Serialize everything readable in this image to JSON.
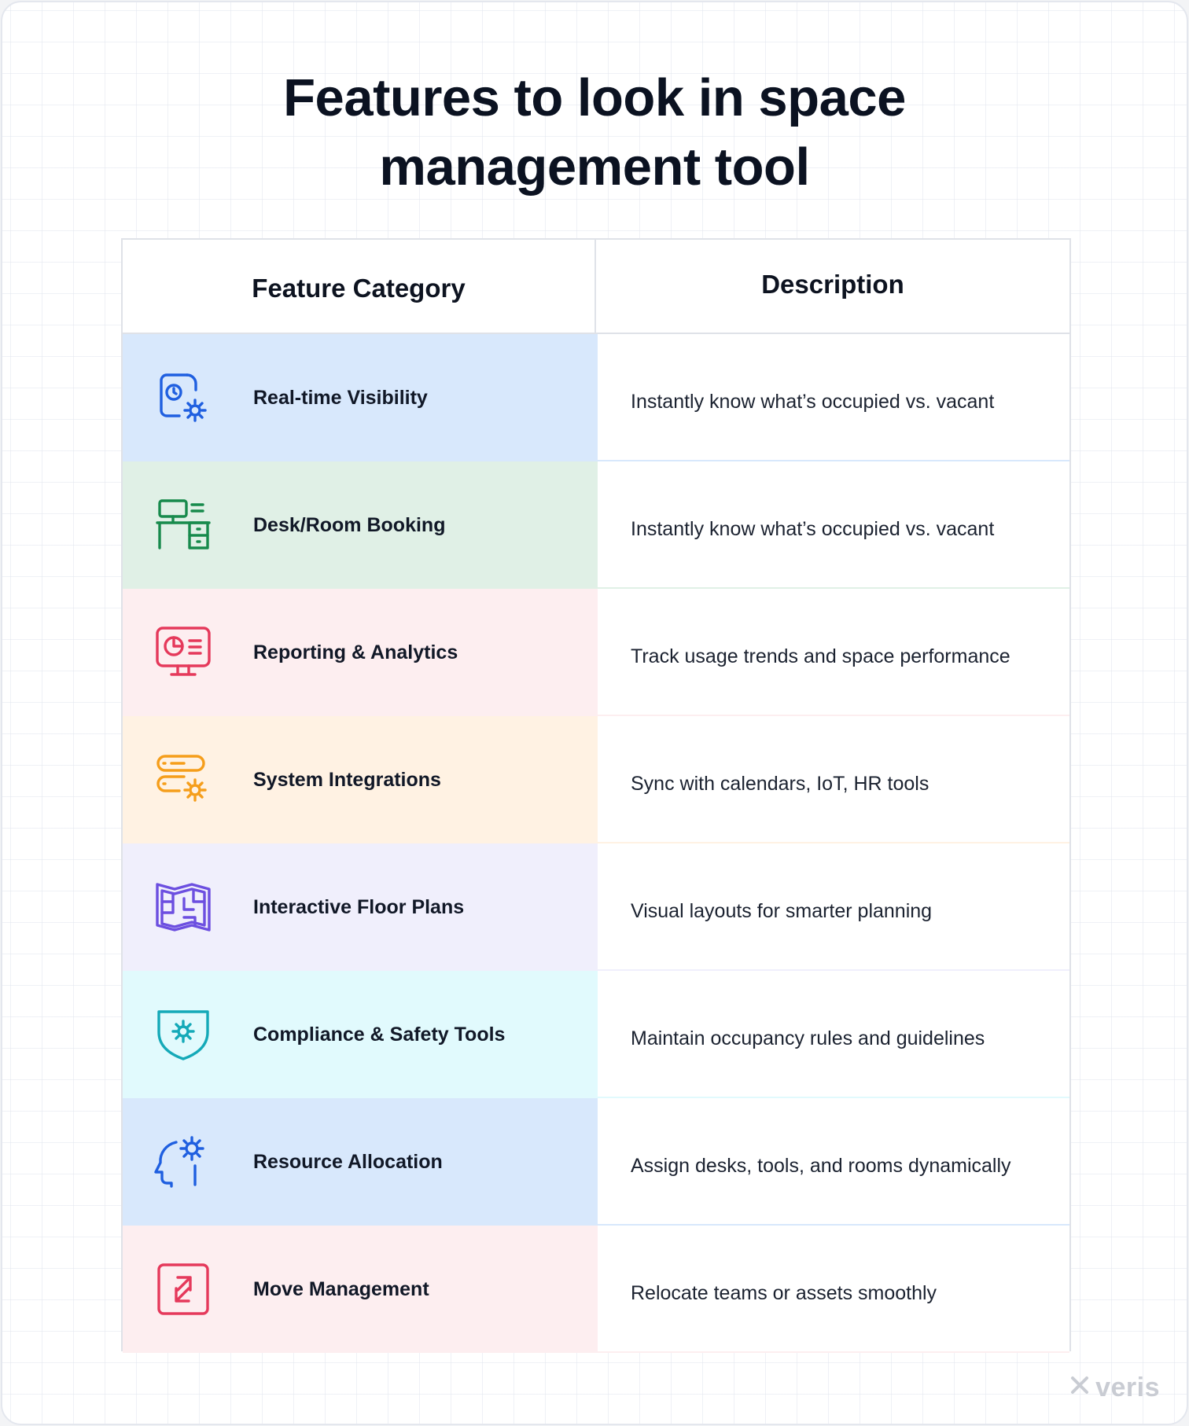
{
  "title_lines": [
    "Features to look in space",
    "management tool"
  ],
  "table": {
    "headers": {
      "category": "Feature Category",
      "description": "Description"
    },
    "rows": [
      {
        "category": "Real-time Visibility",
        "description": "Instantly know what’s occupied vs. vacant",
        "icon": "visibility-gear-icon",
        "bg": "#d8e8fc",
        "accent": "#1f5fe0"
      },
      {
        "category": "Desk/Room Booking",
        "description": "Instantly know what’s occupied vs. vacant",
        "icon": "desk-icon",
        "bg": "#e0f0e6",
        "accent": "#178a4c"
      },
      {
        "category": "Reporting & Analytics",
        "description": "Track usage trends and space performance",
        "icon": "analytics-monitor-icon",
        "bg": "#fdeef0",
        "accent": "#e5395b"
      },
      {
        "category": "System Integrations",
        "description": "Sync with calendars, IoT, HR tools",
        "icon": "server-gear-icon",
        "bg": "#fff2e3",
        "accent": "#f59e1b"
      },
      {
        "category": "Interactive Floor Plans",
        "description": "Visual layouts for smarter planning",
        "icon": "floor-plan-map-icon",
        "bg": "#f0effc",
        "accent": "#6c4fe0"
      },
      {
        "category": "Compliance & Safety Tools",
        "description": "Maintain occupancy rules and guidelines",
        "icon": "shield-gear-icon",
        "bg": "#e1fafd",
        "accent": "#14a9b8"
      },
      {
        "category": "Resource Allocation",
        "description": "Assign desks, tools, and rooms dynamically",
        "icon": "head-gear-icon",
        "bg": "#d8e8fc",
        "accent": "#1f5fe0"
      },
      {
        "category": "Move Management",
        "description": "Relocate teams or assets smoothly",
        "icon": "move-arrows-icon",
        "bg": "#fdeef0",
        "accent": "#e5395b"
      }
    ]
  },
  "brand": {
    "name": "veris",
    "icon": "veris-logo-icon"
  }
}
